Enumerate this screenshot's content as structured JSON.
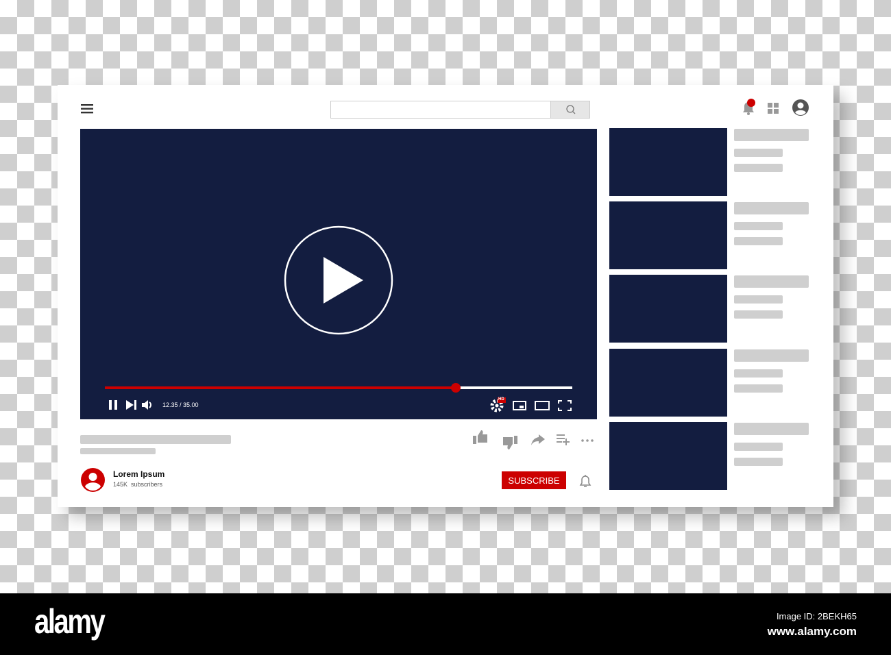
{
  "search": {
    "placeholder": "",
    "icon": "search-icon"
  },
  "player": {
    "time": "12.35 / 35.00",
    "progress": 0.75,
    "hd_badge": "HD"
  },
  "channel": {
    "name": "Lorem Ipsum",
    "subscribers": "145K  subscribers",
    "subscribe_label": "SUBSCRIBE"
  },
  "colors": {
    "accent": "#cc0000",
    "video": "#131d40",
    "placeholder": "#cfcfcf"
  },
  "sidebar": {
    "count": 5
  },
  "footer": {
    "logo": "alamy",
    "image_id": "Image ID: 2BEKH65",
    "url": "www.alamy.com"
  }
}
